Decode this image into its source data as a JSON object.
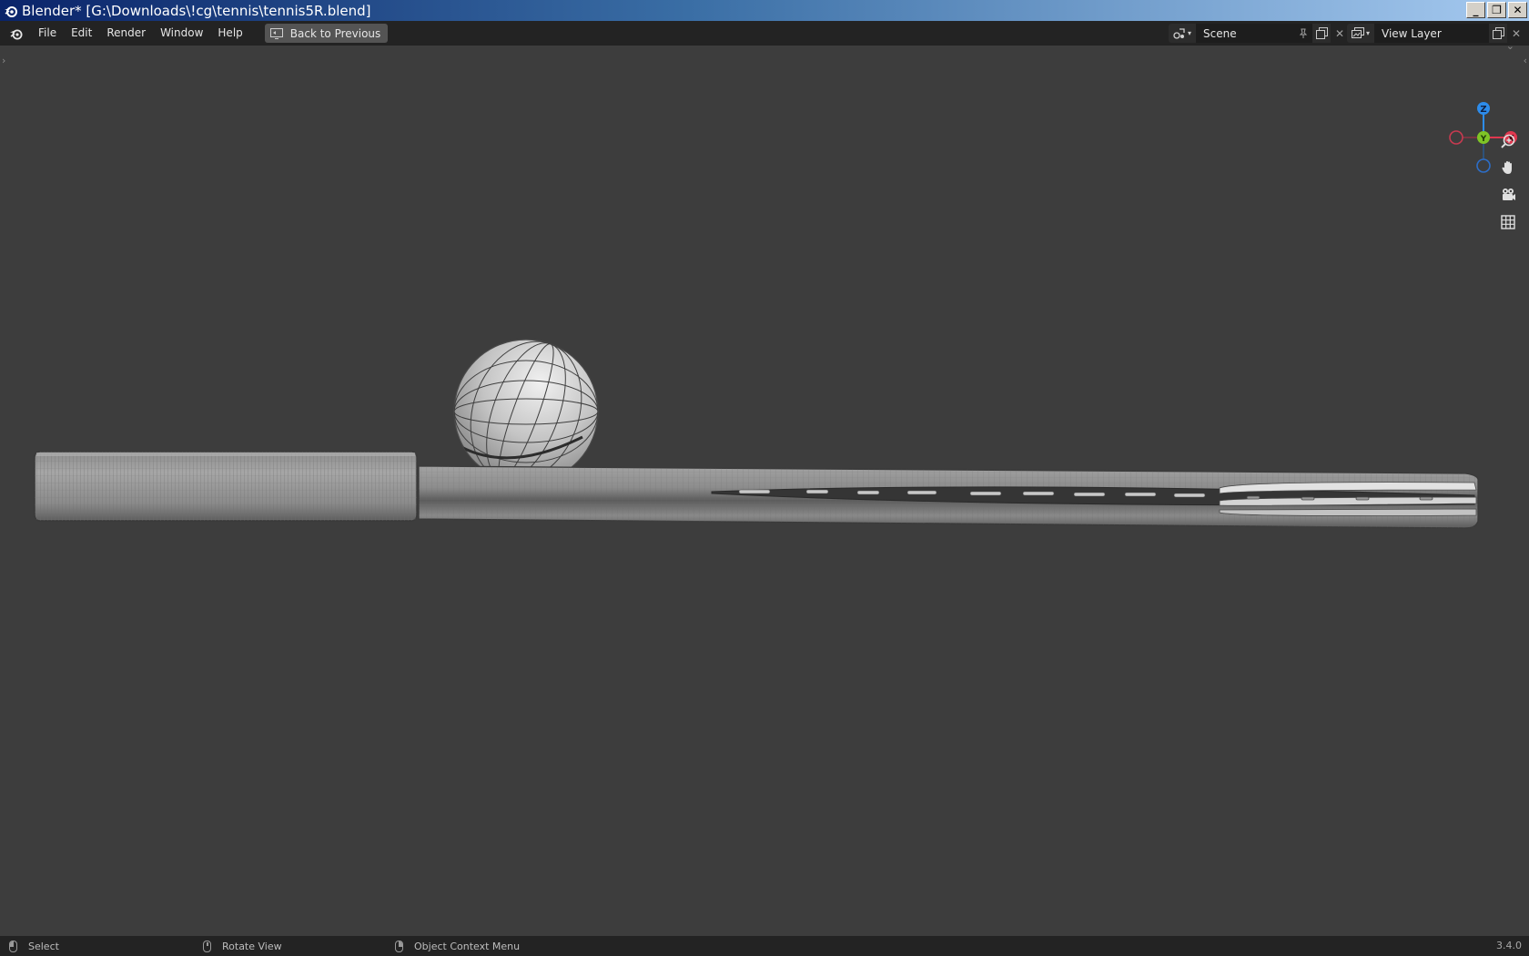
{
  "window": {
    "title": "Blender* [G:\\Downloads\\!cg\\tennis\\tennis5R.blend]",
    "controls": {
      "minimize": "_",
      "restore": "❐",
      "close": "✕"
    }
  },
  "menu": {
    "items": [
      {
        "id": "file",
        "label": "File"
      },
      {
        "id": "edit",
        "label": "Edit"
      },
      {
        "id": "render",
        "label": "Render"
      },
      {
        "id": "window",
        "label": "Window"
      },
      {
        "id": "help",
        "label": "Help"
      }
    ],
    "back_button": "Back to Previous"
  },
  "scene": {
    "name": "Scene"
  },
  "view_layer": {
    "name": "View Layer"
  },
  "gizmo": {
    "z": "Z",
    "y": "Y",
    "x": "X"
  },
  "statusbar": {
    "select": "Select",
    "rotate": "Rotate View",
    "context": "Object Context Menu",
    "version": "3.4.0"
  },
  "colors": {
    "viewport_bg": "#3d3d3d",
    "header_bg": "#232323",
    "axis_x": "#e0384f",
    "axis_y": "#7fc526",
    "axis_z": "#2d8ceb"
  },
  "icons": {
    "blender_logo": "blender-logo-icon",
    "back": "monitor-back-icon",
    "scene": "scene-icon",
    "pin": "pin-icon",
    "new": "duplicate-icon",
    "close": "close-icon",
    "view_layer": "render-layers-icon",
    "zoom": "zoom-icon",
    "pan": "hand-icon",
    "camera": "camera-icon",
    "grid": "grid-icon"
  }
}
